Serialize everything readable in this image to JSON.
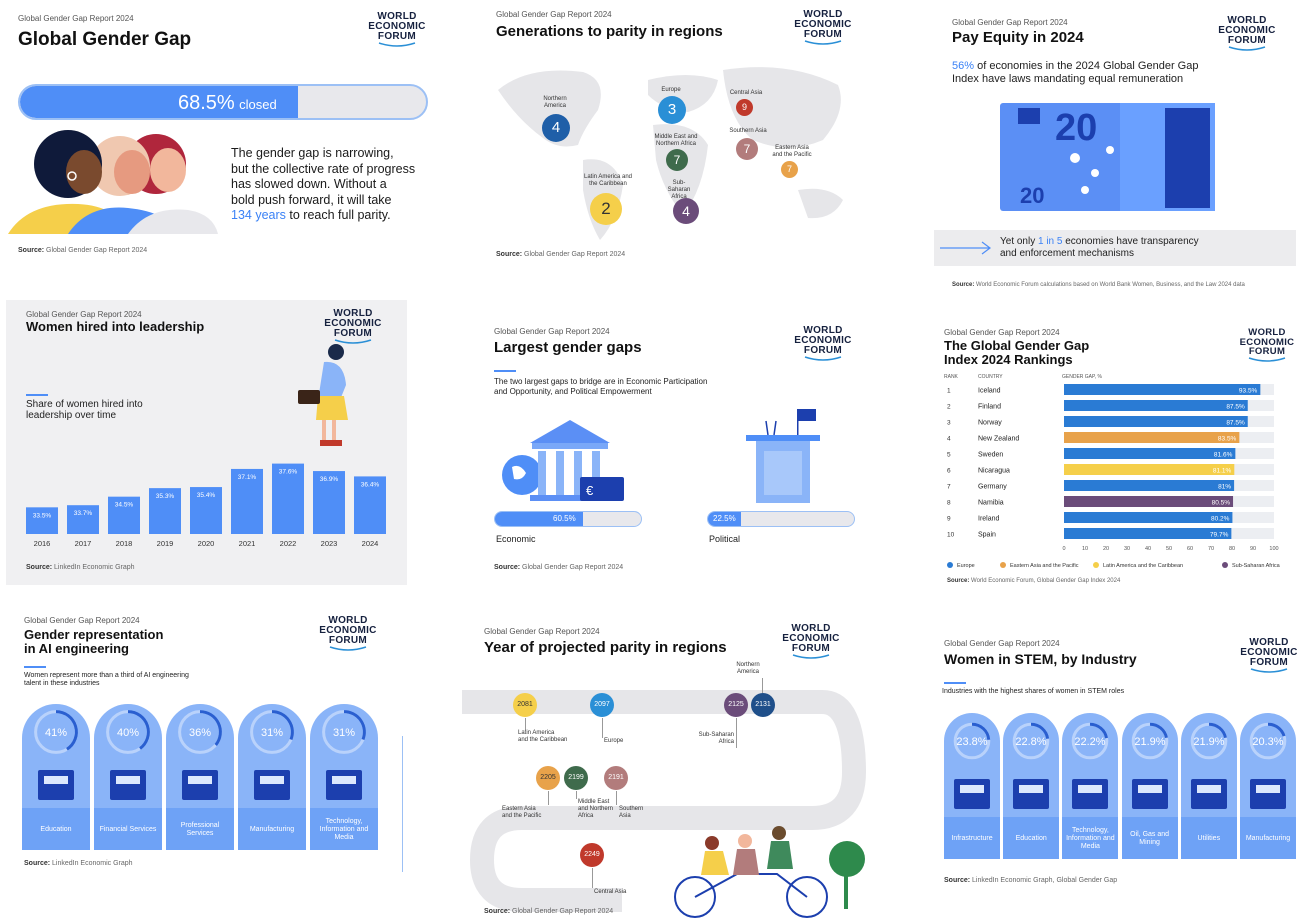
{
  "logo": {
    "line1": "WORLD",
    "line2": "ECONOMIC",
    "line3": "FORUM"
  },
  "p1": {
    "eyebrow": "Global Gender Gap Report 2024",
    "title": "Global Gender Gap",
    "progress_value": "68.5%",
    "progress_suffix": "closed",
    "progress_fraction": 0.685,
    "body_1": "The gender gap is narrowing,",
    "body_2": "but the collective rate of progress",
    "body_3": "has slowed down. Without a",
    "body_4": "bold push forward, it will take",
    "body_highlight": "134 years",
    "body_end": "to reach full parity.",
    "source_label": "Source:",
    "source": "Global Gender Gap Report 2024"
  },
  "p2": {
    "eyebrow": "Global Gender Gap Report 2024",
    "title": "Generations to parity in regions",
    "regions": [
      {
        "label": "Northern America",
        "value": "4",
        "color": "#1f5fa8"
      },
      {
        "label": "Europe",
        "value": "3",
        "color": "#2a8fd6"
      },
      {
        "label": "Central Asia",
        "value": "9",
        "color": "#c0392b"
      },
      {
        "label": "Middle East and Northern Africa",
        "value": "7",
        "color": "#3f6b4c"
      },
      {
        "label": "Southern Asia",
        "value": "7",
        "color": "#b27c7c"
      },
      {
        "label": "Eastern Asia and the Pacific",
        "value": "7",
        "color": "#e8a24a"
      },
      {
        "label": "Latin America and the Caribbean",
        "value": "2",
        "color": "#f5cf4a"
      },
      {
        "label": "Sub-Saharan Africa",
        "value": "4",
        "color": "#6b4c7a"
      }
    ],
    "source_label": "Source:",
    "source": "Global Gender Gap Report 2024"
  },
  "p3": {
    "eyebrow": "Global Gender Gap Report 2024",
    "title": "Pay Equity in 2024",
    "stat_highlight": "56%",
    "stat_1": "of economies in the 2024 Global Gender Gap",
    "stat_2": "Index have laws mandating equal remuneration",
    "note_1_pre": "Yet only",
    "note_1_highlight": "1 in 5",
    "note_1_post": "economies have transparency",
    "note_2": "and enforcement mechanisms",
    "banknote_value": "20",
    "source_label": "Source:",
    "source": "World Economic Forum calculations based on World Bank Women, Business, and the Law 2024 data"
  },
  "p4": {
    "eyebrow": "Global Gender Gap Report 2024",
    "title": "Women hired into leadership",
    "subtitle_1": "Share of women hired into",
    "subtitle_2": "leadership over time",
    "source_label": "Source:",
    "source": "LinkedIn Economic Graph"
  },
  "p5": {
    "eyebrow": "Global Gender Gap Report 2024",
    "title": "Largest gender gaps",
    "desc_1": "The two largest gaps to bridge are in Economic Participation",
    "desc_2": "and Opportunity, and Political Empowerment",
    "economic_value": "60.5%",
    "economic_label": "Economic",
    "economic_fraction": 0.605,
    "political_value": "22.5%",
    "political_label": "Political",
    "political_fraction": 0.225,
    "source_label": "Source:",
    "source": "Global Gender Gap Report 2024"
  },
  "p6": {
    "eyebrow": "Global Gender Gap Report 2024",
    "title_1": "The Global Gender Gap",
    "title_2": "Index 2024 Rankings",
    "col_rank": "RANK",
    "col_country": "COUNTRY",
    "col_gap": "GENDER GAP, %",
    "source_label": "Source:",
    "source": "World Economic Forum, Global Gender Gap Index 2024"
  },
  "p7": {
    "eyebrow": "Global Gender Gap Report 2024",
    "title_1": "Gender representation",
    "title_2": "in AI engineering",
    "desc_1": "Women represent more than a third of AI engineering",
    "desc_2": "talent in these industries",
    "source_label": "Source:",
    "source": "LinkedIn Economic Graph"
  },
  "p8": {
    "eyebrow": "Global Gender Gap Report 2024",
    "title": "Year of projected parity in regions",
    "stops": [
      {
        "year": "2081",
        "label_1": "Latin America",
        "label_2": "and the Caribbean",
        "color": "#f5cf4a"
      },
      {
        "year": "2097",
        "label_1": "Europe",
        "label_2": "",
        "color": "#2a8fd6"
      },
      {
        "year": "2125",
        "label_1": "Sub-Saharan",
        "label_2": "Africa",
        "color": "#6b4c7a"
      },
      {
        "year": "2131",
        "label_1": "Northern",
        "label_2": "America",
        "color": "#1f4f8a"
      },
      {
        "year": "2205",
        "label_1": "Eastern Asia",
        "label_2": "and the Pacific",
        "color": "#e8a24a"
      },
      {
        "year": "2199",
        "label_1": "Middle East",
        "label_2": "and Northern",
        "label_3": "Africa",
        "color": "#3f6b4c"
      },
      {
        "year": "2191",
        "label_1": "Southern",
        "label_2": "Asia",
        "color": "#b27c7c"
      },
      {
        "year": "2249",
        "label_1": "Central Asia",
        "label_2": "",
        "color": "#c0392b"
      }
    ],
    "source_label": "Source:",
    "source": "Global Gender Gap Report 2024"
  },
  "p9": {
    "eyebrow": "Global Gender Gap Report 2024",
    "title": "Women in STEM, by Industry",
    "desc": "Industries with the highest shares of women in STEM roles",
    "source_label": "Source:",
    "source": "LinkedIn Economic Graph, Global Gender Gap"
  },
  "chart_data": [
    {
      "type": "bar",
      "title": "Women hired into leadership",
      "ylabel": "Share of women hired into leadership over time",
      "categories": [
        "2016",
        "2017",
        "2018",
        "2019",
        "2020",
        "2021",
        "2022",
        "2023",
        "2024"
      ],
      "values": [
        33.5,
        33.7,
        34.5,
        35.3,
        35.4,
        37.1,
        37.6,
        36.9,
        36.4
      ],
      "value_labels": [
        "33.5%",
        "33.7%",
        "34.5%",
        "35.3%",
        "35.4%",
        "37.1%",
        "37.6%",
        "36.9%",
        "36.4%"
      ],
      "ylim": [
        31,
        40
      ],
      "color": "#4f8ef7"
    },
    {
      "type": "bar",
      "title": "The Global Gender Gap Index 2024 Rankings",
      "orientation": "horizontal",
      "ranks": [
        "1",
        "2",
        "3",
        "4",
        "5",
        "6",
        "7",
        "8",
        "9",
        "10"
      ],
      "categories": [
        "Iceland",
        "Finland",
        "Norway",
        "New Zealand",
        "Sweden",
        "Nicaragua",
        "Germany",
        "Namibia",
        "Ireland",
        "Spain"
      ],
      "values": [
        93.5,
        87.5,
        87.5,
        83.5,
        81.6,
        81.1,
        81.0,
        80.5,
        80.2,
        79.7
      ],
      "value_labels": [
        "93.5%",
        "87.5%",
        "87.5%",
        "83.5%",
        "81.6%",
        "81.1%",
        "81%",
        "80.5%",
        "80.2%",
        "79.7%"
      ],
      "groups": [
        "Europe",
        "Europe",
        "Europe",
        "Eastern Asia and the Pacific",
        "Europe",
        "Latin America and the Caribbean",
        "Europe",
        "Sub-Saharan Africa",
        "Europe",
        "Europe"
      ],
      "legend": [
        {
          "name": "Europe",
          "color": "#2a7bd4"
        },
        {
          "name": "Eastern Asia and the Pacific",
          "color": "#e8a24a"
        },
        {
          "name": "Latin America and the Caribbean",
          "color": "#f5cf4a"
        },
        {
          "name": "Sub-Saharan Africa",
          "color": "#6b4c7a"
        }
      ],
      "xticks": [
        "0",
        "10",
        "20",
        "30",
        "40",
        "50",
        "60",
        "70",
        "80",
        "90",
        "100"
      ],
      "xlim": [
        0,
        100
      ]
    },
    {
      "type": "bar",
      "title": "Gender representation in AI engineering",
      "categories": [
        "Education",
        "Financial Services",
        "Professional Services",
        "Manufacturing",
        "Technology, Information and Media"
      ],
      "values": [
        41,
        40,
        36,
        31,
        31
      ],
      "value_labels": [
        "41%",
        "40%",
        "36%",
        "31%",
        "31%"
      ],
      "ylim": [
        0,
        100
      ]
    },
    {
      "type": "bar",
      "title": "Women in STEM, by Industry",
      "categories": [
        "Infrastructure",
        "Education",
        "Technology, Information and Media",
        "Oil, Gas and Mining",
        "Utilities",
        "Manufacturing"
      ],
      "values": [
        23.8,
        22.8,
        22.2,
        21.9,
        21.9,
        20.3
      ],
      "value_labels": [
        "23.8%",
        "22.8%",
        "22.2%",
        "21.9%",
        "21.9%",
        "20.3%"
      ],
      "ylim": [
        0,
        100
      ]
    }
  ]
}
